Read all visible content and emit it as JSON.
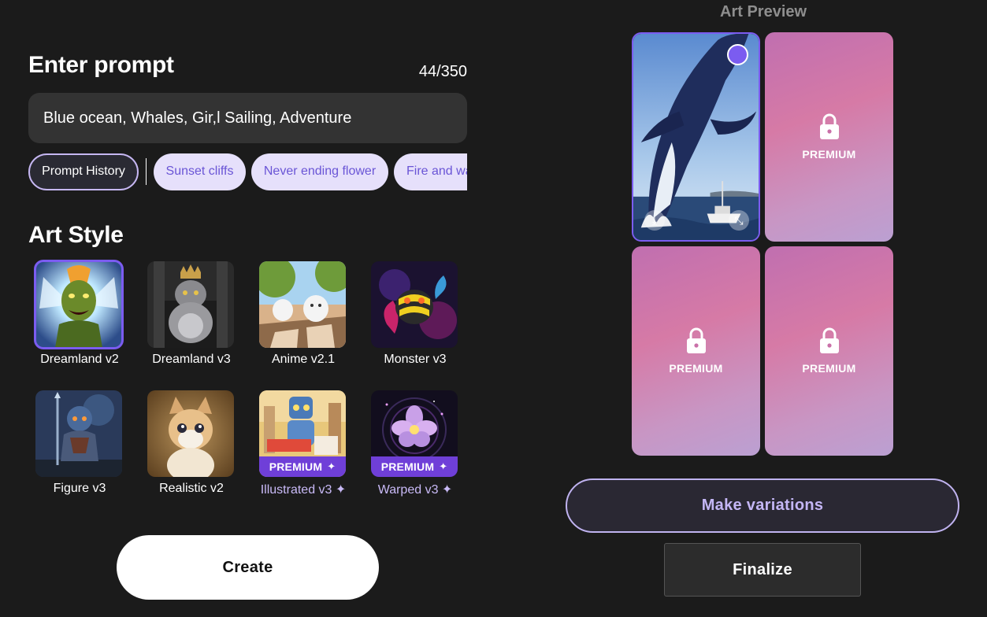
{
  "prompt": {
    "title": "Enter prompt",
    "counter": "44/350",
    "value": "Blue ocean, Whales, Gir,l Sailing, Adventure"
  },
  "chips": {
    "history_label": "Prompt History",
    "suggestions": [
      "Sunset cliffs",
      "Never ending flower",
      "Fire and water"
    ]
  },
  "art_style": {
    "title": "Art Style",
    "premium_badge": "PREMIUM",
    "items": [
      {
        "label": "Dreamland v2",
        "selected": true,
        "premium": false
      },
      {
        "label": "Dreamland v3",
        "selected": false,
        "premium": false
      },
      {
        "label": "Anime v2.1",
        "selected": false,
        "premium": false
      },
      {
        "label": "Monster v3",
        "selected": false,
        "premium": false
      },
      {
        "label": "Figure v3",
        "selected": false,
        "premium": false
      },
      {
        "label": "Realistic v2",
        "selected": false,
        "premium": false
      },
      {
        "label": "Illustrated v3 ✦",
        "selected": false,
        "premium": true
      },
      {
        "label": "Warped v3 ✦",
        "selected": false,
        "premium": true
      }
    ]
  },
  "create_label": "Create",
  "preview": {
    "title": "Art Preview",
    "tiles": [
      {
        "type": "image",
        "selected": true
      },
      {
        "type": "premium",
        "label": "PREMIUM"
      },
      {
        "type": "premium",
        "label": "PREMIUM"
      },
      {
        "type": "premium",
        "label": "PREMIUM"
      }
    ]
  },
  "variations_label": "Make variations",
  "finalize_label": "Finalize",
  "colors": {
    "background": "#1b1b1b",
    "accent": "#7b5cf0",
    "chip_bg": "#e6e0fb",
    "chip_text": "#6a55d6"
  }
}
